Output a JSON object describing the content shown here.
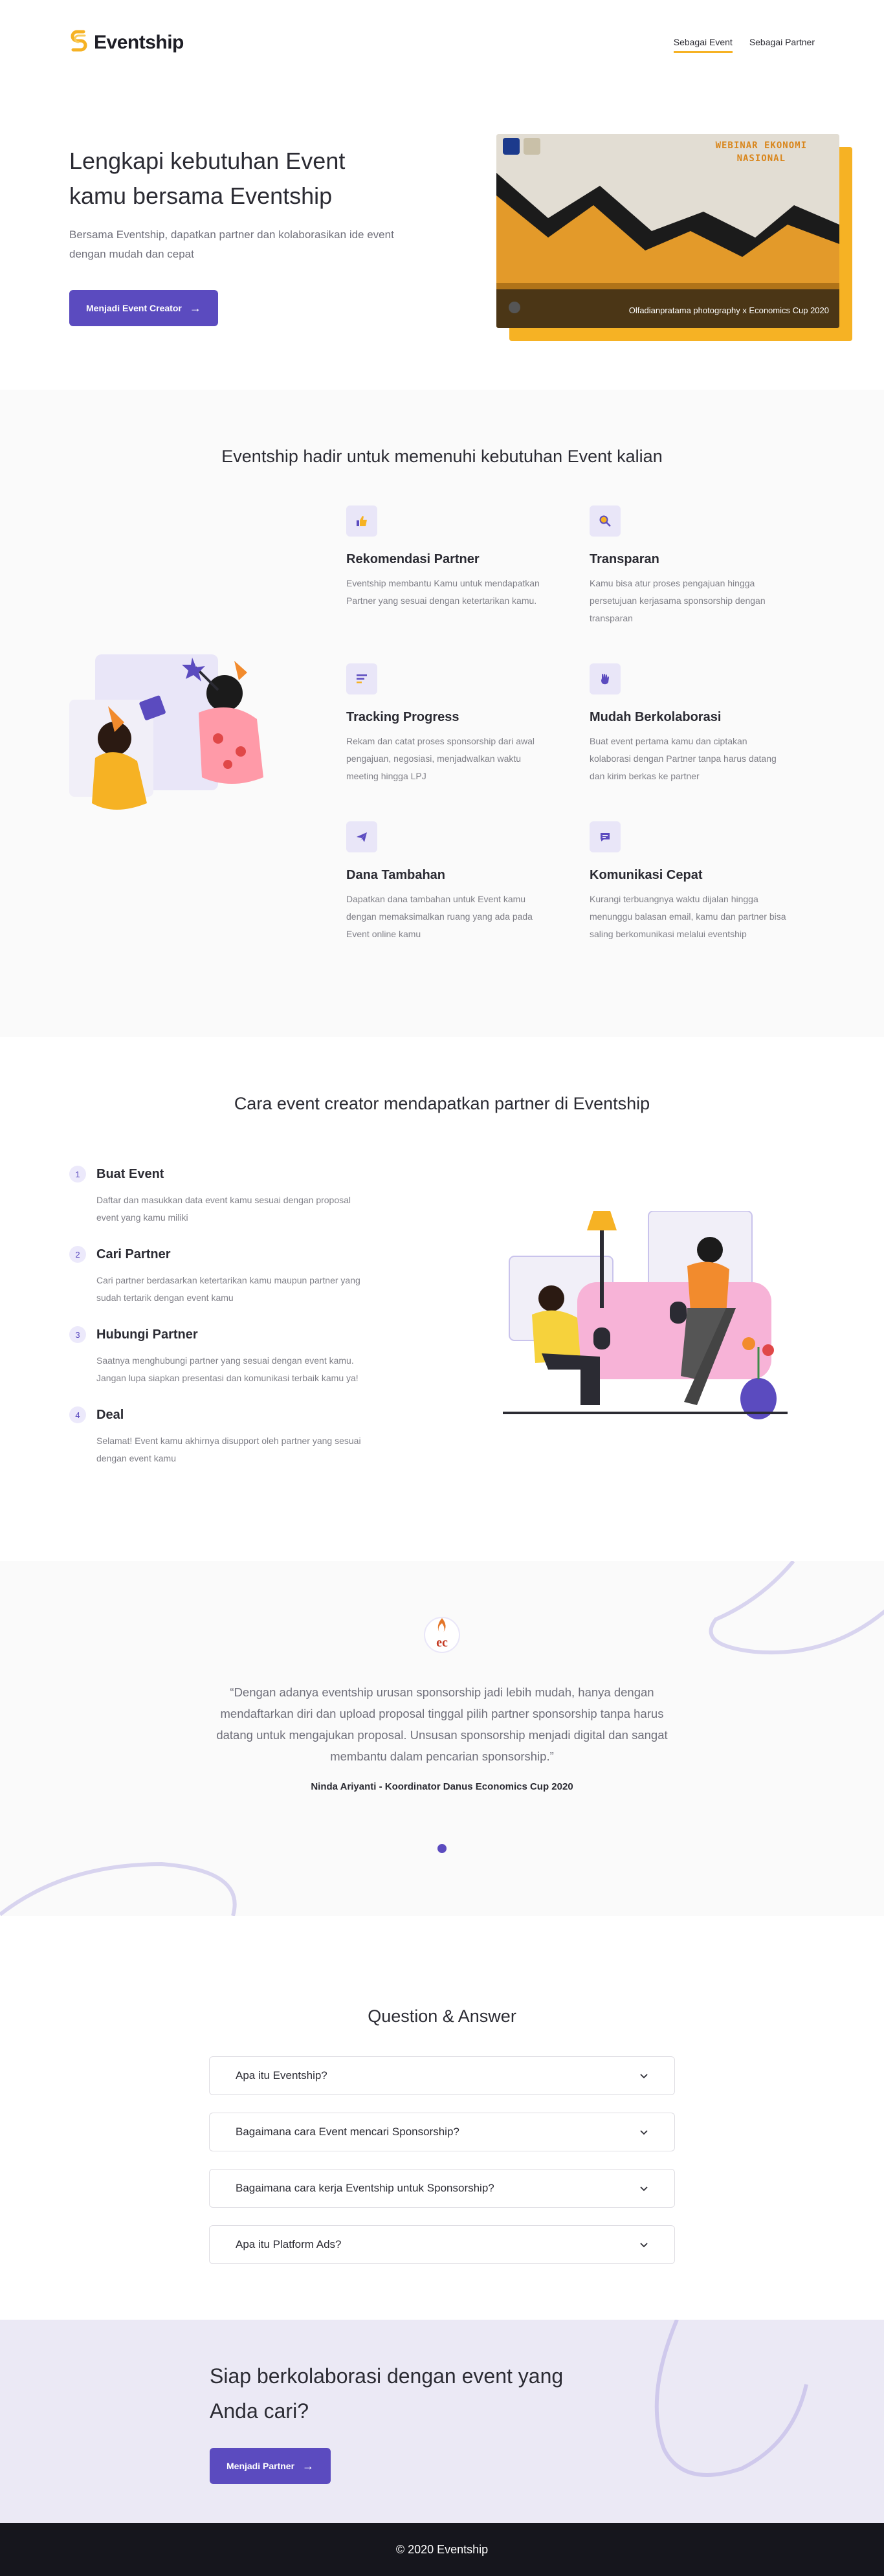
{
  "brand": {
    "name": "Eventship"
  },
  "nav": {
    "items": [
      {
        "label": "Sebagai Event",
        "active": true
      },
      {
        "label": "Sebagai Partner",
        "active": false
      }
    ]
  },
  "hero": {
    "title_line1": "Lengkapi kebutuhan Event",
    "title_line2": "kamu bersama Eventship",
    "subtitle": "Bersama Eventship, dapatkan partner dan kolaborasikan ide event dengan mudah dan cepat",
    "cta_label": "Menjadi Event Creator",
    "photo_title_line1": "WEBINAR EKONOMI",
    "photo_title_line2": "NASIONAL",
    "photo_caption": "Olfadianpratama photography x Economics Cup 2020"
  },
  "features": {
    "title": "Eventship hadir untuk memenuhi kebutuhan Event kalian",
    "items": [
      {
        "icon": "thumbs-up-icon",
        "title": "Rekomendasi Partner",
        "desc": "Eventship membantu Kamu untuk mendapatkan Partner yang sesuai dengan ketertarikan kamu."
      },
      {
        "icon": "search-icon",
        "title": "Transparan",
        "desc": "Kamu bisa atur proses pengajuan hingga persetujuan kerjasama sponsorship dengan transparan"
      },
      {
        "icon": "list-icon",
        "title": "Tracking Progress",
        "desc": "Rekam dan catat proses sponsorship dari awal pengajuan, negosiasi, menjadwalkan waktu meeting hingga LPJ"
      },
      {
        "icon": "hand-icon",
        "title": "Mudah Berkolaborasi",
        "desc": "Buat event pertama kamu dan ciptakan kolaborasi dengan Partner tanpa harus datang dan kirim berkas ke partner"
      },
      {
        "icon": "send-icon",
        "title": "Dana Tambahan",
        "desc": "Dapatkan dana tambahan untuk Event kamu dengan memaksimalkan ruang yang ada pada Event online kamu"
      },
      {
        "icon": "chat-icon",
        "title": "Komunikasi Cepat",
        "desc": "Kurangi terbuangnya waktu dijalan hingga menunggu balasan email, kamu dan partner bisa saling berkomunikasi melalui eventship"
      }
    ]
  },
  "steps": {
    "title": "Cara event creator mendapatkan partner di Eventship",
    "items": [
      {
        "num": "1",
        "title": "Buat Event",
        "desc": "Daftar dan masukkan data event kamu sesuai dengan proposal event yang kamu miliki"
      },
      {
        "num": "2",
        "title": "Cari Partner",
        "desc": "Cari partner berdasarkan ketertarikan kamu maupun partner yang sudah tertarik dengan event kamu"
      },
      {
        "num": "3",
        "title": "Hubungi Partner",
        "desc": "Saatnya menghubungi partner yang sesuai dengan event kamu. Jangan lupa siapkan presentasi dan komunikasi terbaik kamu ya!"
      },
      {
        "num": "4",
        "title": "Deal",
        "desc": "Selamat! Event kamu akhirnya disupport oleh partner yang sesuai dengan event kamu"
      }
    ]
  },
  "testimonial": {
    "quote": "“Dengan adanya eventship urusan sponsorship jadi lebih mudah, hanya dengan mendaftarkan diri dan upload proposal tinggal pilih partner sponsorship tanpa harus datang untuk mengajukan proposal. Unsusan sponsorship menjadi digital dan sangat membantu dalam pencarian sponsorship.”",
    "author": "Ninda Ariyanti - Koordinator Danus Economics Cup 2020",
    "logo_text": "ec"
  },
  "qa": {
    "title": "Question & Answer",
    "items": [
      "Apa itu Eventship?",
      "Bagaimana cara Event mencari Sponsorship?",
      "Bagaimana cara kerja Eventship untuk Sponsorship?",
      "Apa itu Platform Ads?"
    ]
  },
  "cta": {
    "title_line1": "Siap berkolaborasi dengan event yang",
    "title_line2": "Anda cari?",
    "button_label": "Menjadi Partner"
  },
  "footer": {
    "text": "© 2020 Eventship"
  },
  "colors": {
    "primary": "#5b4bbf",
    "accent": "#f6b224",
    "soft": "#e9e6f8",
    "dark": "#16161d"
  }
}
